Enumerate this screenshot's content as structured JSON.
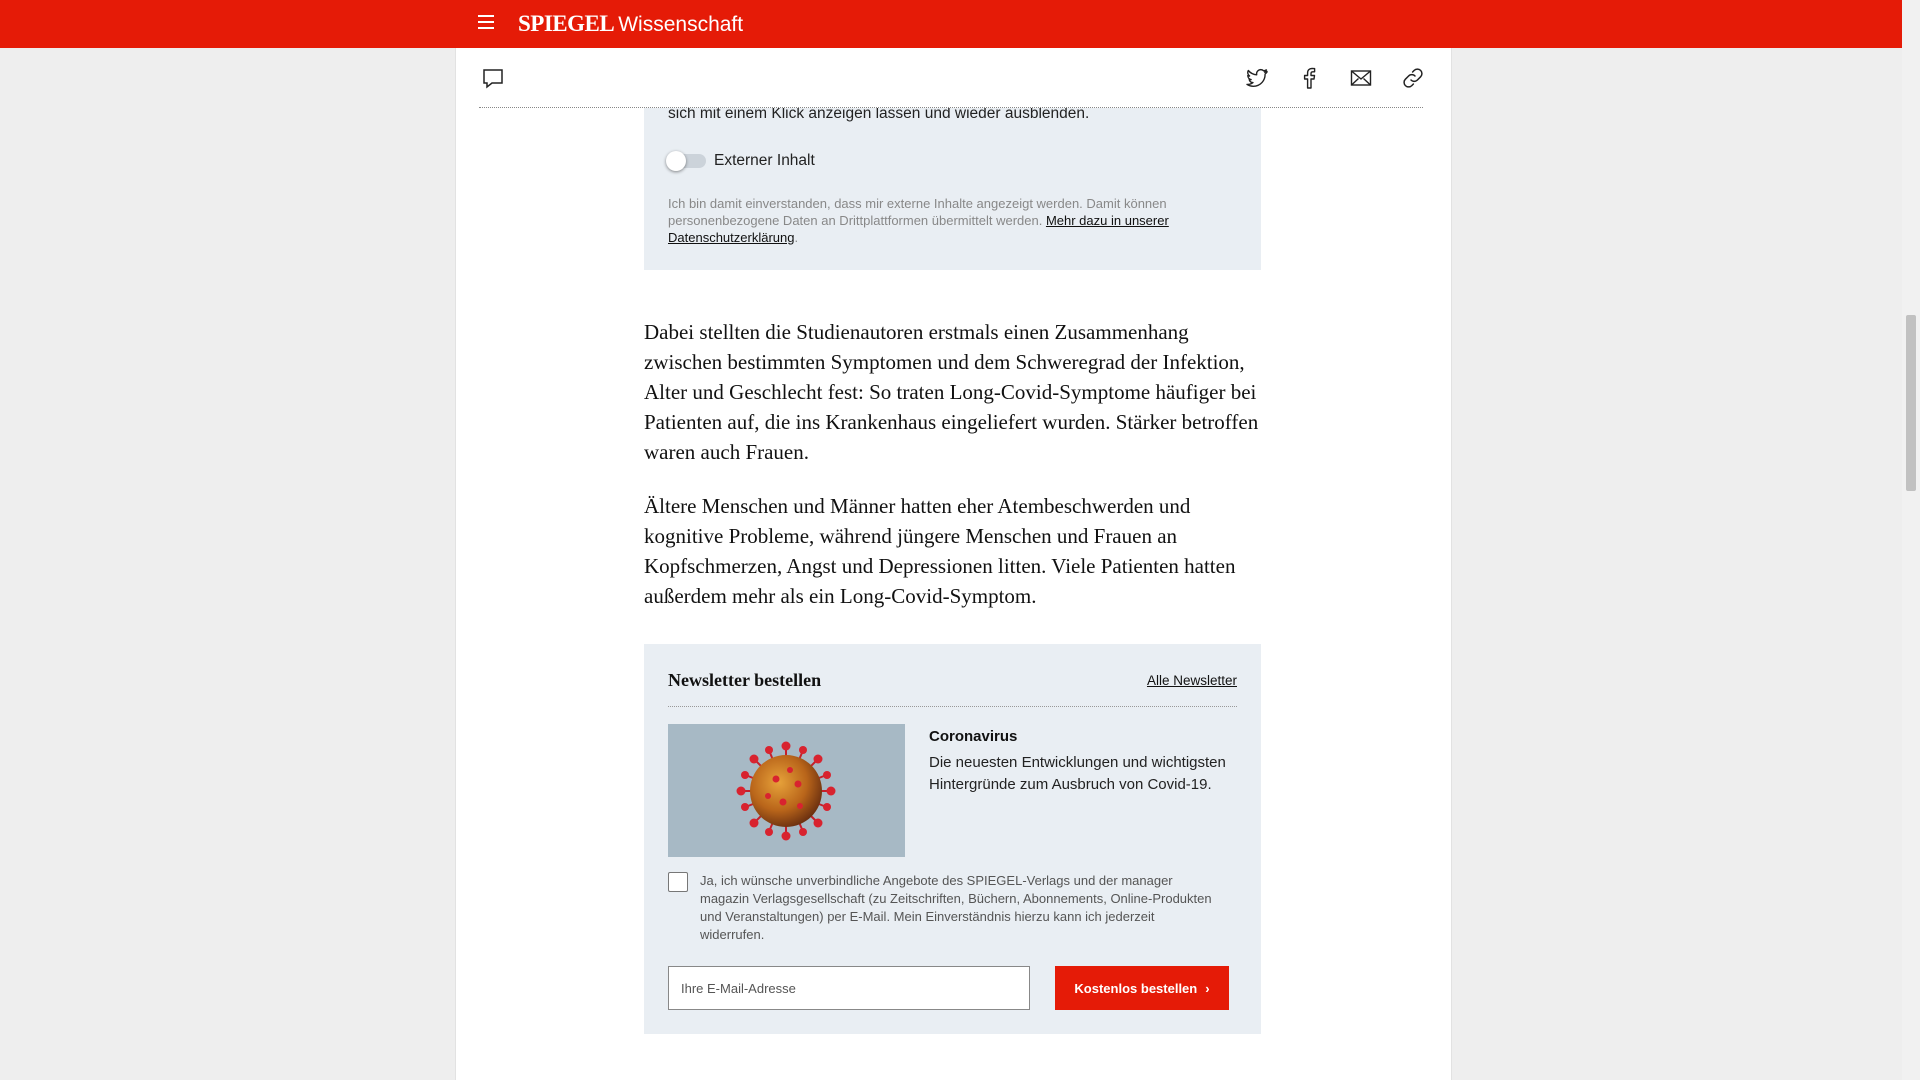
{
  "header": {
    "logo": "SPIEGEL",
    "section": "Wissenschaft"
  },
  "external_content": {
    "text_tail": "sich mit einem Klick anzeigen lassen und wieder ausblenden.",
    "toggle_label": "Externer Inhalt",
    "toggle_on": false,
    "consent_text": "Ich bin damit einverstanden, dass mir externe Inhalte angezeigt werden. Damit können personenbezogene Daten an Drittplattformen übermittelt werden.",
    "consent_link": "Mehr dazu in unserer Datenschutzerklärung",
    "consent_end": "."
  },
  "article": {
    "paragraphs": [
      "Dabei stellten die Studienautoren erstmals einen Zusammenhang zwischen bestimmten Symptomen und dem Schweregrad der Infektion, Alter und Geschlecht fest: So traten Long-Covid-Symptome häufiger bei Patienten auf, die ins Krankenhaus eingeliefert wurden. Stärker betroffen waren auch Frauen.",
      "Ältere Menschen und Männer hatten eher Atembeschwerden und kognitive Probleme, während jüngere Menschen und Frauen an Kopfschmerzen, Angst und Depressionen litten. Viele Patienten hatten außerdem mehr als ein Long-Covid-Symptom."
    ]
  },
  "newsletter": {
    "title": "Newsletter bestellen",
    "all_link": "Alle Newsletter",
    "topic": "Coronavirus",
    "description": "Die neuesten Entwicklungen und wichtigsten Hintergründe zum Ausbruch von Covid-19.",
    "consent": "Ja, ich wünsche unverbindliche Angebote des SPIEGEL-Verlags und der manager magazin Verlagsgesellschaft (zu Zeitschriften, Büchern, Abonnements, Online-Produkten und Veranstaltungen) per E-Mail. Mein Einverständnis hierzu kann ich jederzeit widerrufen.",
    "email_placeholder": "Ihre E-Mail-Adresse",
    "button_label": "Kostenlos bestellen",
    "button_chevron": "›"
  },
  "colors": {
    "brand_red": "#e51b07",
    "box_background": "#e9eef3"
  },
  "icons": [
    "menu-icon",
    "comment-icon",
    "twitter-icon",
    "facebook-icon",
    "mail-icon",
    "link-icon",
    "chevron-right-icon"
  ]
}
